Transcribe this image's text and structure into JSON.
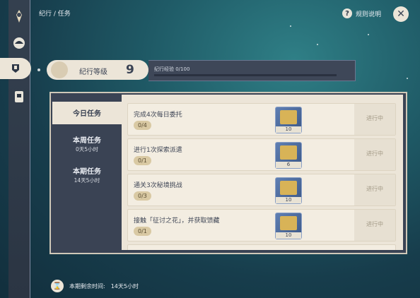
{
  "header": {
    "breadcrumb": "纪行 / 任务",
    "rules_label": "规则说明",
    "close_glyph": "✕"
  },
  "level": {
    "label": "纪行等级",
    "value": "9",
    "exp_text": "纪行经验 0/100",
    "exp_progress": 0.0
  },
  "tabs": [
    {
      "label": "今日任务",
      "sub": ""
    },
    {
      "label": "本周任务",
      "sub": "0天5小时"
    },
    {
      "label": "本期任务",
      "sub": "14天5小时"
    }
  ],
  "tasks": [
    {
      "title": "完成4次每日委托",
      "progress": "0/4",
      "reward_count": "10",
      "status": "进行中"
    },
    {
      "title": "进行1次探索派遣",
      "progress": "0/1",
      "reward_count": "6",
      "status": "进行中"
    },
    {
      "title": "通关3次秘境挑战",
      "progress": "0/3",
      "reward_count": "10",
      "status": "进行中"
    },
    {
      "title": "接触「征讨之花」，并获取馈藏",
      "progress": "0/1",
      "reward_count": "10",
      "status": "进行中"
    }
  ],
  "footer": {
    "label": "本期剩余时间:",
    "value": "14天5小时"
  },
  "icons": {
    "sidebar": [
      "paimon-emblem-icon",
      "shell-icon",
      "bp-icon",
      "card-icon"
    ],
    "rules": "question-icon",
    "close": "close-icon",
    "footer": "bp-clock-icon"
  },
  "colors": {
    "panel_cream": "#ece5d8",
    "panel_dark": "#3a4354",
    "progress_chip": "#d9c9a3"
  }
}
